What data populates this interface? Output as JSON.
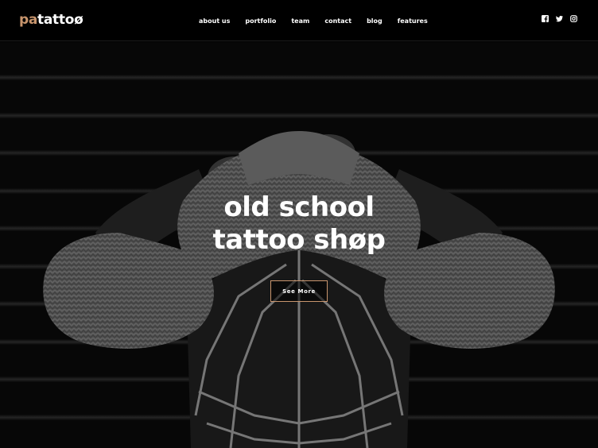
{
  "brand": {
    "logo_prefix": "pa",
    "logo_name": "tattoø",
    "accent": "#c8956d"
  },
  "nav": {
    "items": [
      "about us",
      "portfolio",
      "team",
      "contact",
      "blog",
      "features"
    ]
  },
  "social": {
    "icons": [
      "facebook-icon",
      "twitter-icon",
      "instagram-icon"
    ]
  },
  "hero": {
    "title_line1": "old school",
    "title_line2": "tattoo shøp",
    "button": "See More"
  }
}
